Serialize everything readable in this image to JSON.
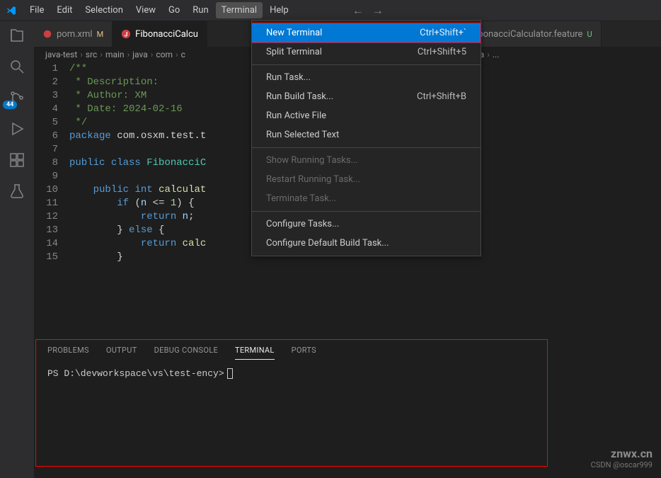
{
  "menubar": {
    "items": [
      "File",
      "Edit",
      "Selection",
      "View",
      "Go",
      "Run",
      "Terminal",
      "Help"
    ],
    "active_index": 6
  },
  "activity_bar": {
    "badge_value": "44"
  },
  "tabs": [
    {
      "label": "pom.xml",
      "status": "M",
      "icon_color": "#cc3e44",
      "active": false
    },
    {
      "label": "FibonacciCalcu",
      "status": "",
      "icon_color": "#cc3e44",
      "icon_letter": "J",
      "active": true
    },
    {
      "label": "FibonacciCalculator.feature",
      "status": "U",
      "icon_color": "#73c991",
      "active": false
    }
  ],
  "breadcrumb": {
    "parts": [
      "java-test",
      "src",
      "main",
      "java",
      "com",
      "c"
    ],
    "suffix": "Calculator.java",
    "ellipsis": "..."
  },
  "code": {
    "line_start": 1,
    "lines": [
      {
        "n": 1,
        "html": "<span class='tok-comment'>/**</span>"
      },
      {
        "n": 2,
        "html": "<span class='tok-comment'> * Description:</span>"
      },
      {
        "n": 3,
        "html": "<span class='tok-comment'> * Author: XM</span>"
      },
      {
        "n": 4,
        "html": "<span class='tok-comment'> * Date: 2024-02-16</span>"
      },
      {
        "n": 5,
        "html": "<span class='tok-comment'> */</span>"
      },
      {
        "n": 6,
        "html": "<span class='tok-keyword'>package</span> <span class='tok-package'>com.osxm.test.t</span>"
      },
      {
        "n": 7,
        "html": ""
      },
      {
        "n": 8,
        "html": "<span class='tok-keyword'>public</span> <span class='tok-keyword'>class</span> <span class='tok-type'>FibonacciC</span>"
      },
      {
        "n": 9,
        "html": ""
      },
      {
        "n": 10,
        "html": "    <span class='tok-keyword'>public</span> <span class='tok-keyword'>int</span> <span class='tok-method'>calculat</span>"
      },
      {
        "n": 11,
        "html": "        <span class='tok-keyword'>if</span> <span class='tok-op'>(</span><span class='tok-var'>n</span> <span class='tok-op'>&lt;=</span> <span class='tok-num'>1</span><span class='tok-op'>) {</span>"
      },
      {
        "n": 12,
        "html": "            <span class='tok-keyword'>return</span> <span class='tok-var'>n</span><span class='tok-op'>;</span>"
      },
      {
        "n": 13,
        "html": "        <span class='tok-op'>}</span> <span class='tok-keyword'>else</span> <span class='tok-op'>{</span>"
      },
      {
        "n": 14,
        "html": "            <span class='tok-keyword'>return</span> <span class='tok-method'>calc</span>"
      },
      {
        "n": 15,
        "html": "        <span class='tok-op'>}</span>"
      }
    ]
  },
  "dropdown": {
    "groups": [
      [
        {
          "label": "New Terminal",
          "shortcut": "Ctrl+Shift+`",
          "highlighted": true
        },
        {
          "label": "Split Terminal",
          "shortcut": "Ctrl+Shift+5"
        }
      ],
      [
        {
          "label": "Run Task..."
        },
        {
          "label": "Run Build Task...",
          "shortcut": "Ctrl+Shift+B"
        },
        {
          "label": "Run Active File"
        },
        {
          "label": "Run Selected Text"
        }
      ],
      [
        {
          "label": "Show Running Tasks...",
          "disabled": true
        },
        {
          "label": "Restart Running Task...",
          "disabled": true
        },
        {
          "label": "Terminate Task...",
          "disabled": true
        }
      ],
      [
        {
          "label": "Configure Tasks..."
        },
        {
          "label": "Configure Default Build Task..."
        }
      ]
    ]
  },
  "panel": {
    "tabs": [
      "PROBLEMS",
      "OUTPUT",
      "DEBUG CONSOLE",
      "TERMINAL",
      "PORTS"
    ],
    "active_tab_index": 3,
    "terminal_line": "PS D:\\devworkspace\\vs\\test-ency>"
  },
  "watermark": {
    "main": "znwx.cn",
    "sub": "CSDN @oscar999"
  }
}
